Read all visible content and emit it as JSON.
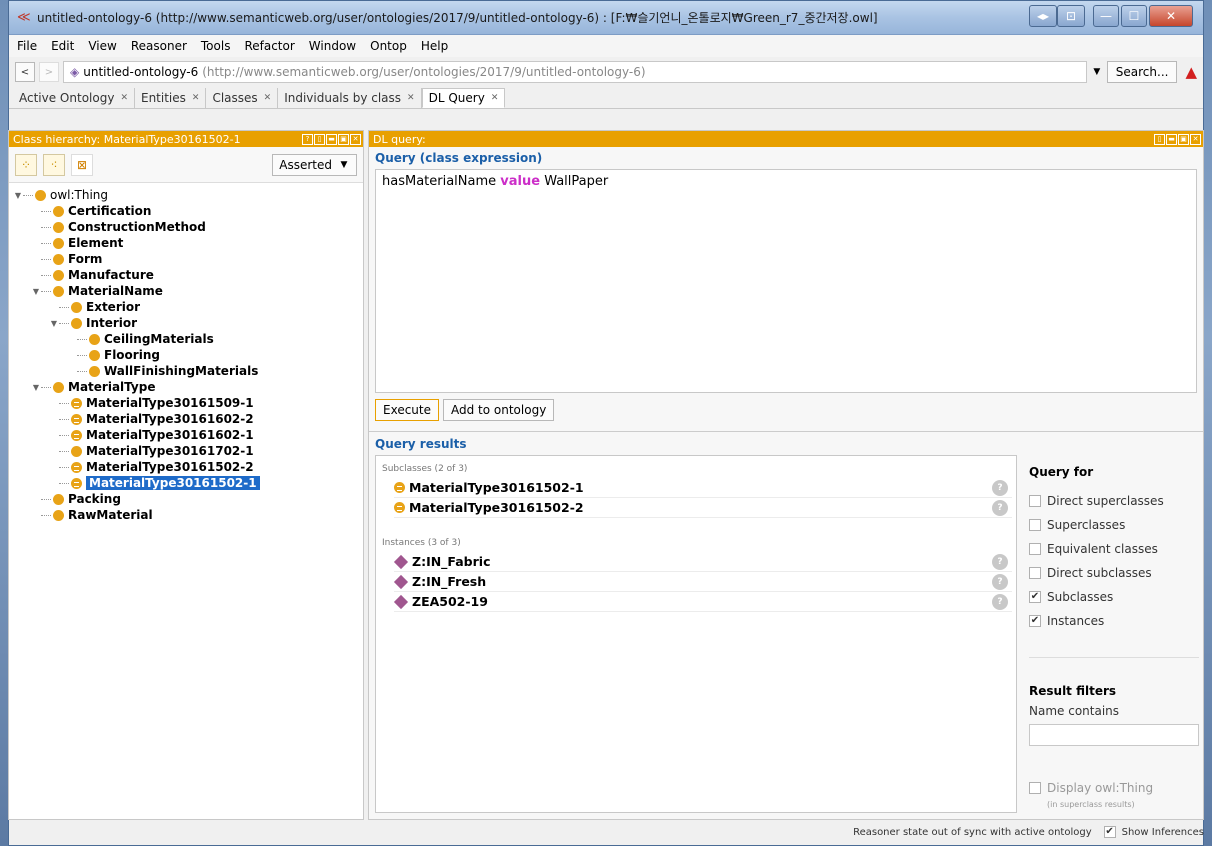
{
  "window": {
    "title": "untitled-ontology-6 (http://www.semanticweb.org/user/ontologies/2017/9/untitled-ontology-6) : [F:₩슬기언니_온톨로지₩Green_r7_중간저장.owl]"
  },
  "menu": [
    "File",
    "Edit",
    "View",
    "Reasoner",
    "Tools",
    "Refactor",
    "Window",
    "Ontop",
    "Help"
  ],
  "address": {
    "name": "untitled-ontology-6",
    "url": "(http://www.semanticweb.org/user/ontologies/2017/9/untitled-ontology-6)",
    "search_label": "Search..."
  },
  "tabs": [
    {
      "label": "Active Ontology"
    },
    {
      "label": "Entities"
    },
    {
      "label": "Classes"
    },
    {
      "label": "Individuals by class"
    },
    {
      "label": "DL Query"
    }
  ],
  "left_panel": {
    "header": "Class hierarchy: MaterialType30161502-1",
    "asserted_label": "Asserted",
    "tree": [
      {
        "label": "owl:Thing",
        "level": 0,
        "expanded": true,
        "root": true
      },
      {
        "label": "Certification",
        "level": 1
      },
      {
        "label": "ConstructionMethod",
        "level": 1
      },
      {
        "label": "Element",
        "level": 1
      },
      {
        "label": "Form",
        "level": 1
      },
      {
        "label": "Manufacture",
        "level": 1
      },
      {
        "label": "MaterialName",
        "level": 1,
        "expanded": true
      },
      {
        "label": "Exterior",
        "level": 2
      },
      {
        "label": "Interior",
        "level": 2,
        "expanded": true
      },
      {
        "label": "CeilingMaterials",
        "level": 3
      },
      {
        "label": "Flooring",
        "level": 3
      },
      {
        "label": "WallFinishingMaterials",
        "level": 3
      },
      {
        "label": "MaterialType",
        "level": 1,
        "expanded": true
      },
      {
        "label": "MaterialType30161509-1",
        "level": 2,
        "eq": true
      },
      {
        "label": "MaterialType30161602-2",
        "level": 2,
        "eq": true
      },
      {
        "label": "MaterialType30161602-1",
        "level": 2,
        "eq": true
      },
      {
        "label": "MaterialType30161702-1",
        "level": 2
      },
      {
        "label": "MaterialType30161502-2",
        "level": 2,
        "eq": true
      },
      {
        "label": "MaterialType30161502-1",
        "level": 2,
        "eq": true,
        "selected": true
      },
      {
        "label": "Packing",
        "level": 1
      },
      {
        "label": "RawMaterial",
        "level": 1
      }
    ]
  },
  "right_panel": {
    "header": "DL query:",
    "query_title": "Query (class expression)",
    "query": {
      "prefix": "hasMaterialName ",
      "keyword": "value",
      "suffix": " WallPaper"
    },
    "execute_label": "Execute",
    "add_label": "Add to ontology",
    "results_title": "Query results",
    "subclasses_label": "Subclasses (2 of 3)",
    "subclasses": [
      "MaterialType30161502-1",
      "MaterialType30161502-2"
    ],
    "instances_label": "Instances (3 of 3)",
    "instances": [
      "Z:IN_Fabric",
      "Z:IN_Fresh",
      "ZEA502-19"
    ],
    "question_glyph": "?",
    "query_for": {
      "title": "Query for",
      "options": [
        {
          "label": "Direct superclasses",
          "checked": false
        },
        {
          "label": "Superclasses",
          "checked": false
        },
        {
          "label": "Equivalent classes",
          "checked": false
        },
        {
          "label": "Direct subclasses",
          "checked": false
        },
        {
          "label": "Subclasses",
          "checked": true
        },
        {
          "label": "Instances",
          "checked": true
        }
      ]
    },
    "result_filters": {
      "title": "Result filters",
      "name_contains_label": "Name contains",
      "display_owl_thing": "Display owl:Thing",
      "display_note": "(in superclass results)"
    }
  },
  "status": {
    "text": "Reasoner state out of sync with active ontology",
    "show_inferences": "Show Inferences"
  },
  "colors": {
    "accent": "#e8a000",
    "link": "#1b5fa8",
    "keyword": "#cc2ec8",
    "selection": "#1e6bc9",
    "class_dot": "#e8a317",
    "individual": "#a0568f"
  }
}
